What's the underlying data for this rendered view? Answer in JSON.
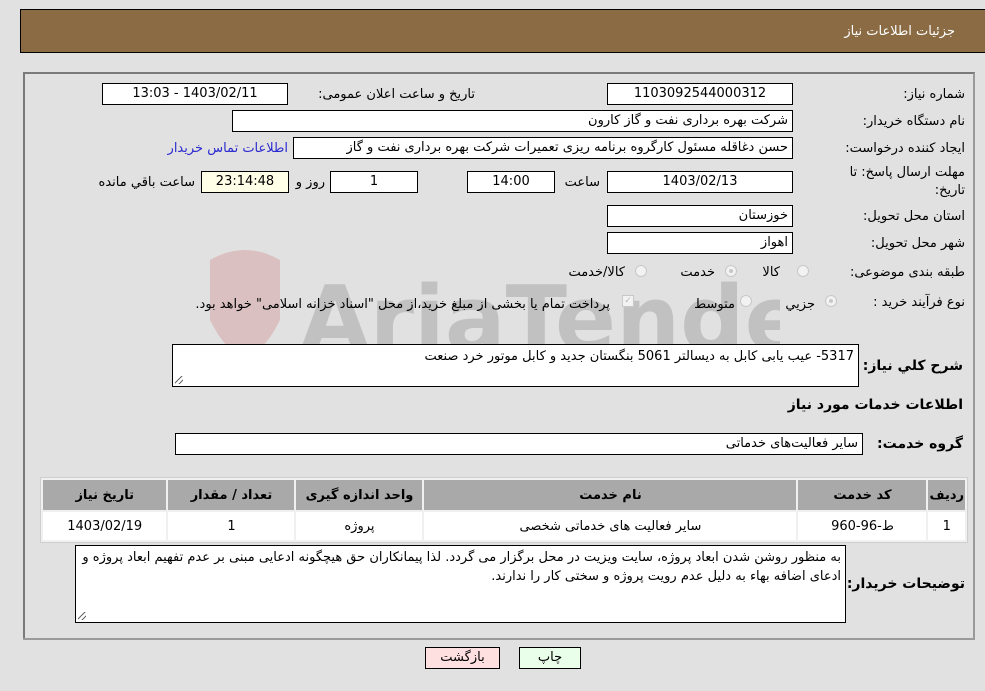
{
  "header": {
    "title": "جزئیات اطلاعات نیاز"
  },
  "form": {
    "need_number": {
      "label": "شماره نیاز:",
      "value": "1103092544000312"
    },
    "announce_datetime": {
      "label": "تاریخ و ساعت اعلان عمومی:",
      "value": "1403/02/11 - 13:03"
    },
    "buyer_org": {
      "label": "نام دستگاه خریدار:",
      "value": "شرکت بهره برداری نفت و گاز کارون"
    },
    "requester": {
      "label": "ایجاد کننده درخواست:",
      "value": "حسن دغاقله مسئول کارگروه برنامه ریزی تعمیرات شرکت بهره برداری نفت و گاز",
      "contact_link": "اطلاعات تماس خریدار"
    },
    "deadline": {
      "label": "مهلت ارسال پاسخ: تا تاریخ:",
      "date": "1403/02/13",
      "time_label": "ساعت",
      "time": "14:00",
      "days": "1",
      "days_label": "روز و",
      "remaining": "23:14:48",
      "remaining_label": "ساعت باقي مانده"
    },
    "province": {
      "label": "استان محل تحویل:",
      "value": "خوزستان"
    },
    "city": {
      "label": "شهر محل تحویل:",
      "value": "اهواز"
    },
    "category": {
      "label": "طبقه بندی موضوعی:",
      "options": [
        "کالا",
        "خدمت",
        "کالا/خدمت"
      ],
      "selected": "خدمت"
    },
    "process_type": {
      "label": "نوع فرآیند خرید :",
      "options": [
        "جزيي",
        "متوسط"
      ],
      "selected": "جزيي",
      "treasury_note": "پرداخت تمام یا بخشی از مبلغ خرید،از محل \"اسناد خزانه اسلامی\" خواهد بود.",
      "treasury_checked": true
    },
    "description": {
      "label": "شرح کلي نیاز:",
      "value": "5317- عیب یابی کابل به دیسالتر 5061 بنگستان جدید و کابل موتور خرد صنعت"
    },
    "services_heading": "اطلاعات خدمات مورد نیاز",
    "service_group": {
      "label": "گروه خدمت:",
      "value": "سایر فعالیت‌های خدماتی"
    }
  },
  "table": {
    "headers": [
      "ردیف",
      "کد خدمت",
      "نام خدمت",
      "واحد اندازه گیری",
      "تعداد / مقدار",
      "تاریخ نیاز"
    ],
    "rows": [
      [
        "1",
        "ط-96-960",
        "سایر فعالیت های خدماتی شخصی",
        "پروژه",
        "1",
        "1403/02/19"
      ]
    ]
  },
  "buyer_notes": {
    "label": "توضیحات خریدار:",
    "value": "به منظور روشن شدن ابعاد پروژه، سایت ویزیت در محل برگزار می گردد. لذا پیمانکاران حق هیچگونه ادعایی مبنی بر عدم تفهیم ابعاد پروژه و ادعای اضافه بهاء به دلیل عدم رویت پروژه و سختی کار را ندارند."
  },
  "buttons": {
    "print": "چاپ",
    "back": "بازگشت"
  },
  "watermark": {
    "text": "AriaTender.neT"
  },
  "colors": {
    "header_bg": "#8b6b43",
    "print_bg": "#eaffea",
    "back_bg": "#ffe0e0",
    "link": "#2a2ad0"
  }
}
